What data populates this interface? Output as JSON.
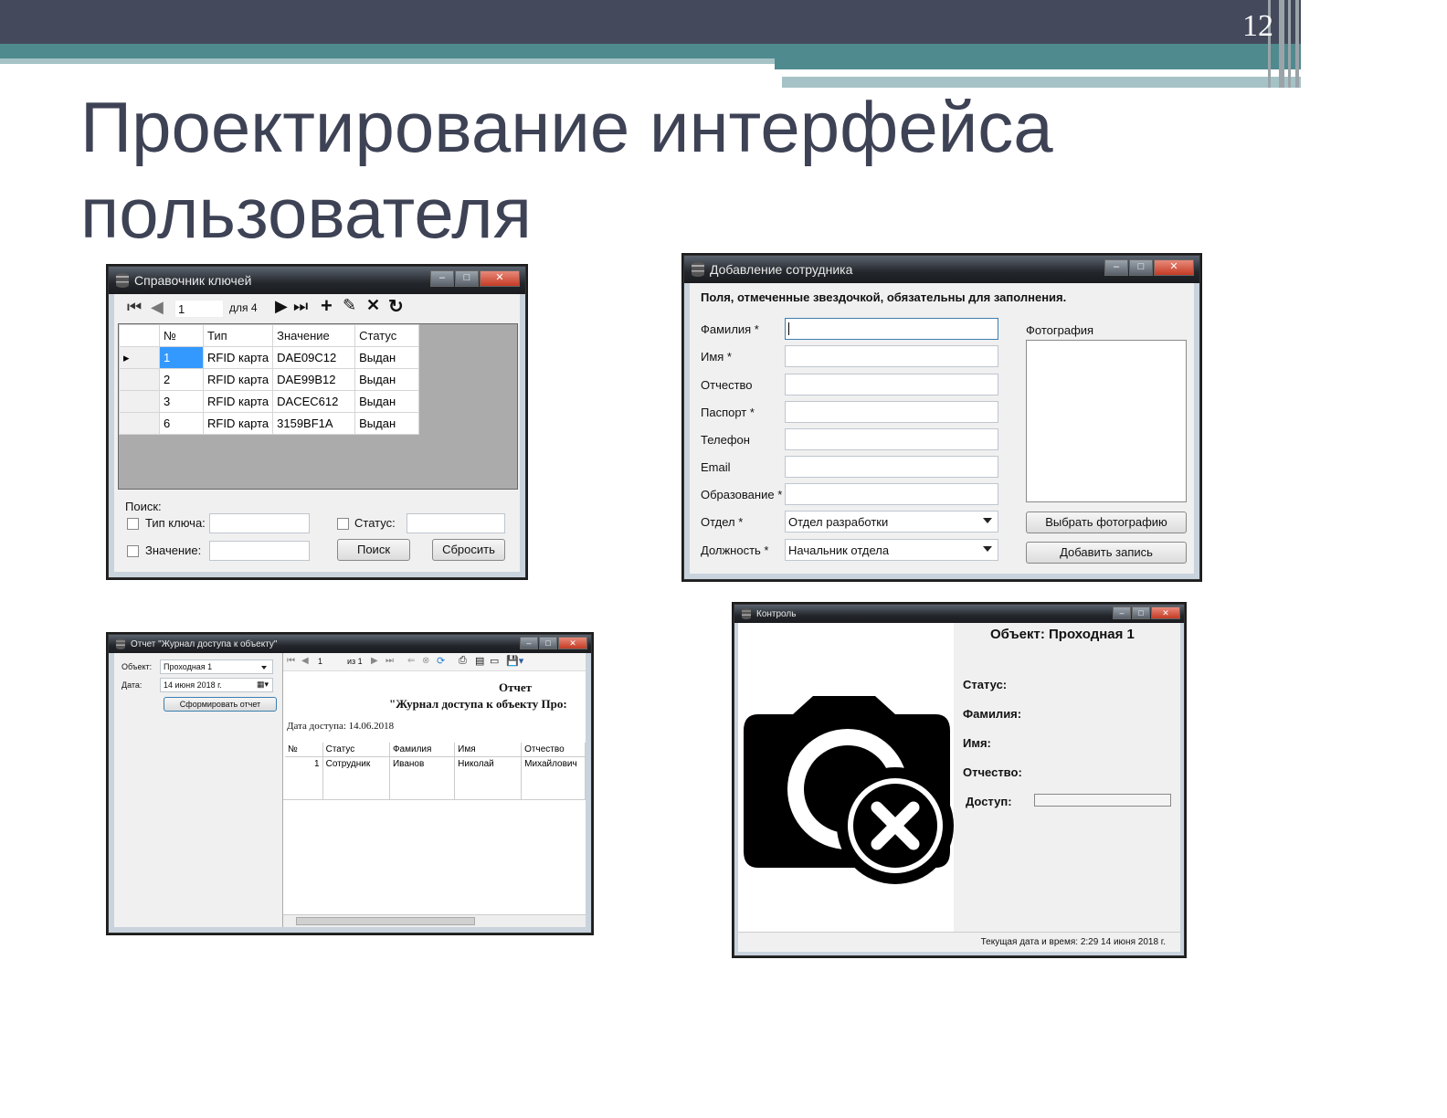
{
  "slide": {
    "number": "12",
    "title": "Проектирование интерфейса пользователя"
  },
  "keys_window": {
    "title": "Справочник ключей",
    "nav": {
      "position": "1",
      "count_label": "для 4"
    },
    "columns": [
      "№",
      "Тип",
      "Значение",
      "Статус"
    ],
    "rows": [
      [
        "1",
        "RFID карта",
        "DAE09C12",
        "Выдан"
      ],
      [
        "2",
        "RFID карта",
        "DAE99B12",
        "Выдан"
      ],
      [
        "3",
        "RFID карта",
        "DACEC612",
        "Выдан"
      ],
      [
        "6",
        "RFID карта",
        "3159BF1A",
        "Выдан"
      ]
    ],
    "search_label": "Поиск:",
    "key_type_label": "Тип ключа:",
    "status_label": "Статус:",
    "value_label": "Значение:",
    "search_button": "Поиск",
    "reset_button": "Сбросить"
  },
  "employee_window": {
    "title": "Добавление сотрудника",
    "hint": "Поля, отмеченные звездочкой, обязательны для заполнения.",
    "fields": {
      "surname": "Фамилия *",
      "name": "Имя *",
      "patronymic": "Отчество",
      "passport": "Паспорт *",
      "phone": "Телефон",
      "email": "Email",
      "education": "Образование *",
      "department": "Отдел *",
      "position": "Должность *"
    },
    "department_value": "Отдел разработки",
    "position_value": "Начальник отдела",
    "photo_label": "Фотография",
    "choose_photo_button": "Выбрать фотографию",
    "add_record_button": "Добавить запись"
  },
  "report_window": {
    "title": "Отчет \"Журнал доступа к объекту\"",
    "object_label": "Объект:",
    "object_value": "Проходная 1",
    "date_label": "Дата:",
    "date_value": "14   июня   2018 г.",
    "generate_button": "Сформировать отчет",
    "page_value": "1",
    "page_of": "из 1",
    "report_heading": "Отчет",
    "report_subheading": "\"Журнал доступа к объекту Про:",
    "access_date": "Дата доступа: 14.06.2018",
    "columns": [
      "№",
      "Статус",
      "Фамилия",
      "Имя",
      "Отчество"
    ],
    "rows": [
      [
        "1",
        "Сотрудник",
        "Иванов",
        "Николай",
        "Михайлович"
      ]
    ]
  },
  "control_window": {
    "title": "Контроль",
    "object_heading": "Объект: Проходная 1",
    "status_label": "Статус:",
    "surname_label": "Фамилия:",
    "name_label": "Имя:",
    "patronymic_label": "Отчество:",
    "access_label": "Доступ:",
    "datetime_label": "Текущая дата и время:  2:29  14 июня 2018 г."
  }
}
